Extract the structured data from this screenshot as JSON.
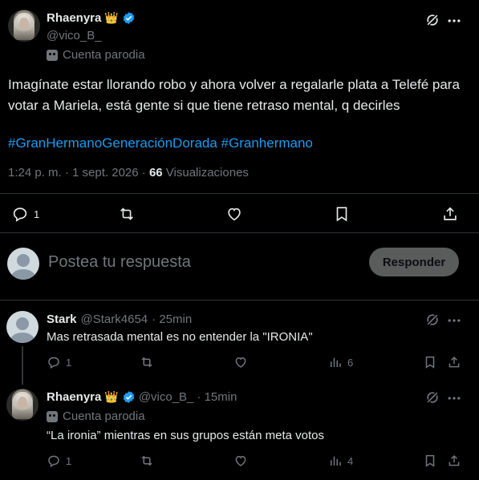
{
  "main_tweet": {
    "display_name": "Rhaenyra",
    "crown": "👑",
    "handle": "@vico_B_",
    "parody_label": "Cuenta parodia",
    "text": "Imagínate estar llorando robo y ahora volver a regalarle plata a Telefé para votar a Mariela, está gente si que tiene retraso mental, q decirles",
    "hashtag1": "#GranHermanoGeneraciónDorada",
    "hashtag2": "#Granhermano",
    "time": "1:24 p. m. · 1 sept. 2026 ·",
    "views_count": "66",
    "views_label": "Visualizaciones",
    "reply_count": "1"
  },
  "reply_box": {
    "placeholder": "Postea tu respuesta",
    "button_label": "Responder"
  },
  "replies": [
    {
      "display_name": "Stark",
      "handle": "@Stark4654",
      "time": "· 25min",
      "text": "Mas retrasada mental es no entender la \"IRONIA\"",
      "reply_count": "1",
      "views": "6"
    },
    {
      "display_name": "Rhaenyra",
      "crown": "👑",
      "handle": "@vico_B_",
      "time": "· 15min",
      "parody_label": "Cuenta parodia",
      "text": "“La ironia” mientras en sus grupos están meta votos",
      "reply_count": "1",
      "views": "4"
    }
  ],
  "icons": [
    "grok-icon",
    "more-icon",
    "reply-icon",
    "retweet-icon",
    "like-icon",
    "bookmark-icon",
    "share-icon",
    "views-icon",
    "verified-badge-icon",
    "parody-mask-icon"
  ],
  "colors": {
    "background": "#000000",
    "text": "#e7e9ea",
    "muted": "#71767b",
    "link": "#1d9bf0",
    "verified": "#1d9bf0",
    "divider": "#2f3336"
  }
}
